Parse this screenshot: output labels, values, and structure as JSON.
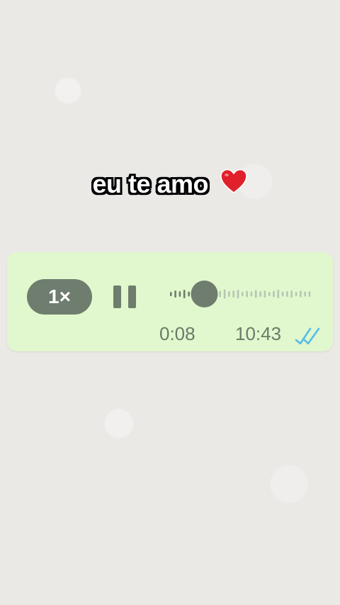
{
  "caption": {
    "text": "eu te amo",
    "emoji": "heart-red"
  },
  "voice_message": {
    "speed_label": "1×",
    "state": "playing",
    "elapsed": "0:08",
    "sent_time": "10:43",
    "read_status": "read",
    "progress": 0.24,
    "colors": {
      "bubble": "#e1f7cd",
      "control": "#6f7d6e",
      "ticks": "#53bdeb",
      "played": "#6f7d6e",
      "unplayed": "#b7c6b4"
    }
  }
}
